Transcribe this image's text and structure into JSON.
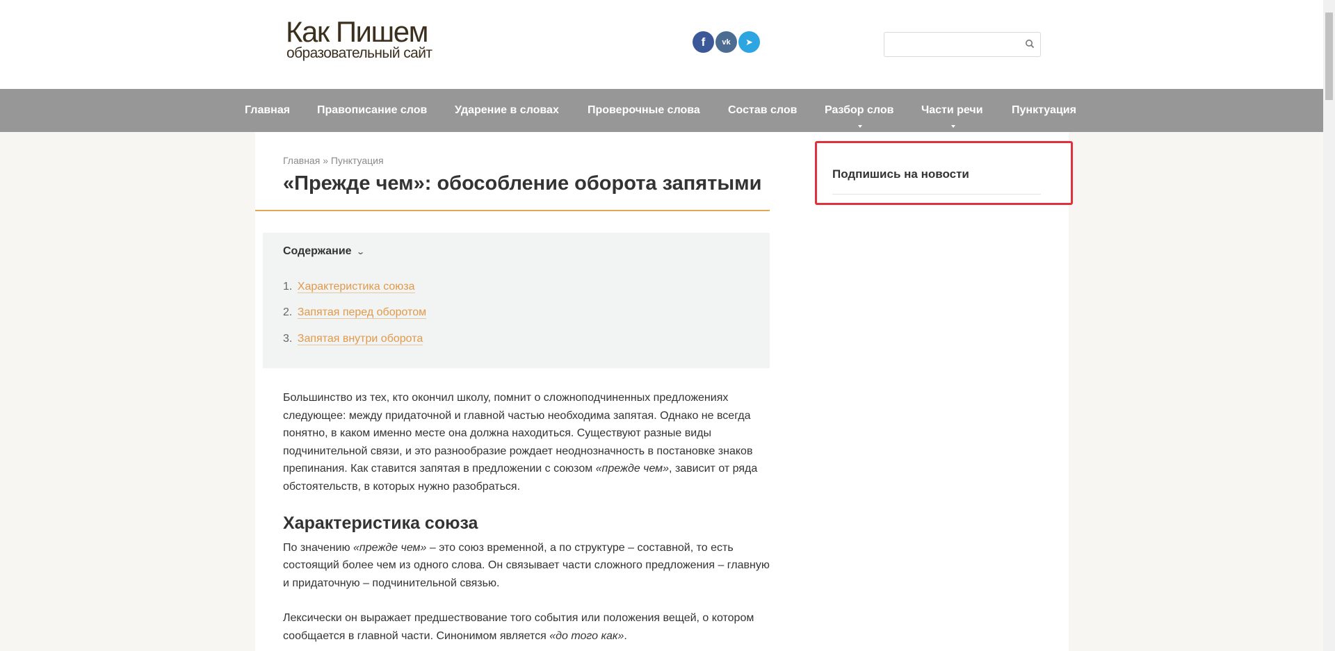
{
  "header": {
    "logo_main": "Как Пишем",
    "logo_sub": "образовательный сайт",
    "social": [
      {
        "name": "facebook-icon",
        "glyph": "f"
      },
      {
        "name": "vk-icon",
        "glyph": "vk"
      },
      {
        "name": "telegram-icon",
        "glyph": "➤"
      }
    ],
    "search": {
      "value": "",
      "placeholder": ""
    }
  },
  "nav": {
    "items": [
      {
        "label": "Главная",
        "has_submenu": false
      },
      {
        "label": "Правописание слов",
        "has_submenu": false
      },
      {
        "label": "Ударение в словах",
        "has_submenu": false
      },
      {
        "label": "Проверочные слова",
        "has_submenu": false
      },
      {
        "label": "Состав слов",
        "has_submenu": false
      },
      {
        "label": "Разбор слов",
        "has_submenu": true
      },
      {
        "label": "Части речи",
        "has_submenu": true
      },
      {
        "label": "Пунктуация",
        "has_submenu": false
      }
    ]
  },
  "breadcrumb": {
    "home": "Главная",
    "separator": "»",
    "current": "Пунктуация"
  },
  "article": {
    "title": "«Прежде чем»: обособление оборота запятыми",
    "toc": {
      "title": "Содержание",
      "items": [
        {
          "num": "1.",
          "label": "Характеристика союза"
        },
        {
          "num": "2.",
          "label": "Запятая перед оборотом"
        },
        {
          "num": "3.",
          "label": "Запятая внутри оборота"
        }
      ]
    },
    "intro": {
      "text_before": "Большинство из тех, кто окончил школу, помнит о сложноподчиненных предложениях следующее: между придаточной и главной частью необходима запятая. Однако не всегда понятно, в каком именно месте она должна находиться. Существуют разные виды подчинительной связи, и это разнообразие рождает неоднозначность в постановке знаков препинания. Как ставится запятая в предложении с союзом ",
      "emph": "«прежде чем»",
      "text_after": ", зависит от ряда обстоятельств, в которых нужно разобраться."
    },
    "section1_heading": "Характеристика союза",
    "section1_p1": {
      "text_before": "По значению ",
      "emph": "«прежде чем»",
      "text_after": " – это союз временной, а по структуре – составной, то есть состоящий более чем из одного слова. Он связывает части сложного предложения – главную и придаточную – подчинительной связью."
    },
    "section1_p2": {
      "text_before": "Лексически он выражает предшествование того события или положения вещей, о котором сообщается в главной части. Синонимом является ",
      "emph": "«до того как»",
      "text_after": "."
    }
  },
  "sidebar": {
    "widget_title": "Подпишись на новости"
  },
  "colors": {
    "nav_bg": "#979797",
    "accent": "#e09a4a",
    "highlight_border": "#e0323b"
  }
}
